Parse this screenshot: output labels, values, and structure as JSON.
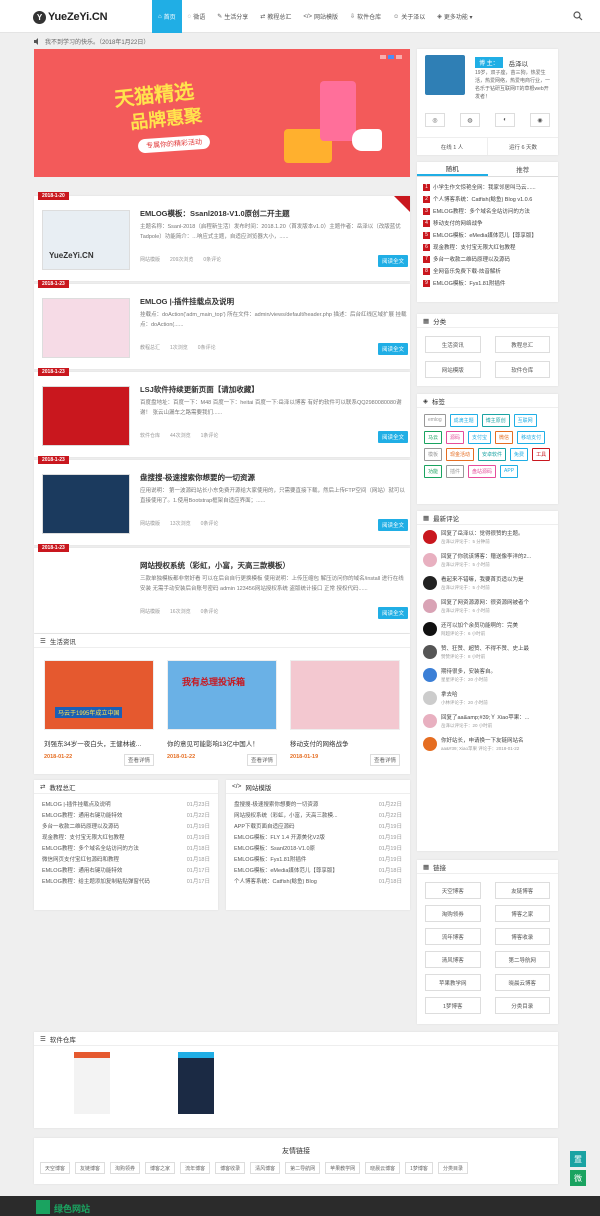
{
  "header": {
    "logo": "YueZeYi.CN",
    "nav": [
      {
        "icon": "home-icon",
        "glyph": "⌂",
        "label": "首页",
        "active": true
      },
      {
        "icon": "chat-icon",
        "glyph": "◌",
        "label": "微语"
      },
      {
        "icon": "edit-icon",
        "glyph": "✎",
        "label": "生活分享"
      },
      {
        "icon": "shuffle-icon",
        "glyph": "⇄",
        "label": "教程总汇"
      },
      {
        "icon": "code-icon",
        "glyph": "</>",
        "label": "网站模版"
      },
      {
        "icon": "download-icon",
        "glyph": "⇩",
        "label": "软件仓库"
      },
      {
        "icon": "user-icon",
        "glyph": "☺",
        "label": "关于泽以"
      },
      {
        "icon": "tag-icon",
        "glyph": "◈",
        "label": "更多功能 ▾"
      }
    ]
  },
  "notice": {
    "text": "我不到学习的快乐。（2018年1月22日）"
  },
  "slider": {
    "line1": "天猫精选",
    "line2": "品牌惠聚",
    "sub": "专属你的精彩活动"
  },
  "posts": [
    {
      "date": "2018-1-20",
      "title": "EMLOG模板：Ssanl2018-V1.0原创二开主题",
      "excerpt": "主题名称：Ssanl-2018（启程新生活）发布时间：2018.1.20（首发版本v1.0）主题作者：岳泽以（改版蓝优Tadpole）功能简介：...响应式主题，自适应浏览器大小，......",
      "cat": "网站模版",
      "views": "209次浏览",
      "comments": "0条评论",
      "more": "阅读全文",
      "top": true
    },
    {
      "date": "2018-1-23",
      "title": "EMLOG |-插件挂载点及说明",
      "excerpt": "挂载点：doAction('adm_main_top') 所在文件：admin/views/default/header.php 描述：后台红线区域扩展 挂载点：doAction(......",
      "cat": "教程总汇",
      "views": "1次浏览",
      "comments": "0条评论",
      "more": "阅读全文"
    },
    {
      "date": "2018-1-23",
      "title": "LSJ软件持续更新页面【请加收藏】",
      "excerpt": "百度盘地址：百度一下：M48 百度一下：heitai 百度一下:岳泽以博客 有好的软件可以联系QQ2980080080谢谢！ 张云山漏车之路需要我们......",
      "cat": "软件仓库",
      "views": "44次浏览",
      "comments": "1条评论",
      "more": "阅读全文"
    },
    {
      "date": "2018-1-23",
      "title": "盘搜搜-极速搜索你想要的一切资源",
      "excerpt": "应用说明：  第一波源码站长小东免费开源给大家使用的，只需要直接下载，然后上传FTP空间（网站）就可以直接使用了。1.使用Bootstrap框架自适应界面；......",
      "cat": "网站模版",
      "views": "13次浏览",
      "comments": "0条评论",
      "more": "阅读全文"
    },
    {
      "date": "2018-1-23",
      "title": "网站授权系统（彩虹，小富，天高三款模板）",
      "excerpt": "三款单独模板都非常好看 可以在后台自行更换模板 使用说明：上传压缩包 解压访问你的域名/install 进行在线安装 无需手动安装后台账号密码 admin 123456网站授权系统 盗版统计接口 正常 授权代码......",
      "cat": "网站模版",
      "views": "16次浏览",
      "comments": "0条评论",
      "more": "阅读全文"
    }
  ],
  "life": {
    "title": "生活资讯",
    "items": [
      {
        "title": "刘强东34岁一夜白头，王健林被...",
        "date": "2018-01-22",
        "btn": "查看详情",
        "img": "马云于1995年成立中国"
      },
      {
        "title": "你的意见可能影响13亿中国人！",
        "date": "2018-01-22",
        "btn": "查看详情",
        "img": "我有总理投诉箱"
      },
      {
        "title": "移动支付的网络战争",
        "date": "2018-01-19",
        "btn": "查看详情",
        "img": ""
      }
    ]
  },
  "tutorials": {
    "title": "教程总汇",
    "items": [
      {
        "t": "EMLOG |-插件挂载点及说明",
        "d": "01月23日"
      },
      {
        "t": "EMLOG教程：通用右键功能特效",
        "d": "01月22日"
      },
      {
        "t": "多台一收款二维码原理以及源码",
        "d": "01月19日"
      },
      {
        "t": "现金教程：支付宝无限大红包教程",
        "d": "01月19日"
      },
      {
        "t": "EMLOG教程：多个域名全站访问的方法",
        "d": "01月18日"
      },
      {
        "t": "微信网页支付宝红包源码和教程",
        "d": "01月18日"
      },
      {
        "t": "EMLOG教程：通用右键功能特效",
        "d": "01月17日"
      },
      {
        "t": "EMLOG教程：给主题添加复制粘贴弹窗代码",
        "d": "01月17日"
      }
    ]
  },
  "templates": {
    "title": "网站模版",
    "items": [
      {
        "t": "盘搜搜-极速搜索你想要的一切资源",
        "d": "01月22日"
      },
      {
        "t": "网站授权系统（彩虹，小富，天高三款模...",
        "d": "01月22日"
      },
      {
        "t": "APP下载页面自适应源码",
        "d": "01月19日"
      },
      {
        "t": "EMLOG模板：FLY 1.4 开源美化V2版",
        "d": "01月19日"
      },
      {
        "t": "EMLOG模板：Ssanl2018-V1.0原",
        "d": "01月19日"
      },
      {
        "t": "EMLOG模板：Fys1.81附插件",
        "d": "01月19日"
      },
      {
        "t": "EMLOG模板：eMedia媒体范儿【尊享版】",
        "d": "01月18日"
      },
      {
        "t": "个人博客系统：Catfish(鲶鱼) Blog",
        "d": "01月18日"
      }
    ]
  },
  "software": {
    "title": "软件仓库"
  },
  "links": {
    "title": "友情链接",
    "items": [
      "天空博客",
      "友链博客",
      "淘购领券",
      "博客之家",
      "流年博客",
      "博客收录",
      "清风博客",
      "第二导航网",
      "苹果教学网",
      "晓晨云博客",
      "1梦博客",
      "分类目录"
    ]
  },
  "profile": {
    "badge": "博 主：",
    "name": "岳泽以",
    "bio": "19岁，双子座，苗三狗，热爱生活，热爱网络，热爱电商行业，一名乐于钻研互联网IT的草根web开发者！",
    "online": "在线 1 人",
    "uptime": "运行 6 天数"
  },
  "rank": {
    "tabs": [
      "随机",
      "推荐"
    ],
    "items": [
      "小学生作文惊艳全网：我家邻居叫马云......",
      "个人博客系统：Catfish(鲶鱼) Blog v1.0.6",
      "EMLOG教程：多个域名全站访问的方法",
      "移动支付的网络战争",
      "EMLOG模板：eMedia媒体范儿【尊享版】",
      "现金教程：支付宝无限大红包教程",
      "多台一收款二维码原理以及源码",
      "全网音乐免费下载-炫音解析",
      "EMLOG模板：Fys1.81附插件"
    ]
  },
  "categories": {
    "title": "分类",
    "items": [
      "生活资讯",
      "教程总汇",
      "网站模版",
      "软件仓库"
    ]
  },
  "tagbox": {
    "title": "标签",
    "items": [
      {
        "t": "emlog",
        "c": "#999"
      },
      {
        "t": "成滴主题",
        "c": "#20aee5"
      },
      {
        "t": "博主原创",
        "c": "#1aa3a3"
      },
      {
        "t": "互联网",
        "c": "#20aee5"
      },
      {
        "t": "马云",
        "c": "#1aa360"
      },
      {
        "t": "源码",
        "c": "#e54d9b"
      },
      {
        "t": "支付宝",
        "c": "#20aee5"
      },
      {
        "t": "微信",
        "c": "#e56d21"
      },
      {
        "t": "移动支付",
        "c": "#20aee5"
      },
      {
        "t": "模板",
        "c": "#999"
      },
      {
        "t": "现金活动",
        "c": "#e56d21"
      },
      {
        "t": "安卓软件",
        "c": "#1aa3a3"
      },
      {
        "t": "免费",
        "c": "#20aee5"
      },
      {
        "t": "工具",
        "c": "#c9171e"
      },
      {
        "t": "功能",
        "c": "#1aa360"
      },
      {
        "t": "插件",
        "c": "#999"
      },
      {
        "t": "盘站源码",
        "c": "#e54d9b"
      },
      {
        "t": "APP",
        "c": "#20aee5"
      }
    ]
  },
  "comments": {
    "title": "最新评论",
    "items": [
      {
        "t": "回复了岳泽以：觉得很赞的主题。",
        "m": "岳泽以评论于：5 分钟前"
      },
      {
        "t": "回复了你就该博客：赠送像李洋的2...",
        "m": "岳泽以评论于：5 小时前"
      },
      {
        "t": "看起来不错嘛，我要首页适以为是",
        "m": "岳泽以评论于：5 小时前"
      },
      {
        "t": "回复了网资源源网：很资源网被者个",
        "m": "岳泽以评论于：6 小时前"
      },
      {
        "t": "还可以加个余员功能啊的：完美",
        "m": "阿超评论于：6 小时前"
      },
      {
        "t": "赞、狂赞、超赞、不得不赞、史上最",
        "m": "赞赞评论于：8 小时前"
      },
      {
        "t": "期待很多，安装客自。",
        "m": "星星评论于：20 小时前"
      },
      {
        "t": "拿去哈",
        "m": "小林评论于：20 小时前"
      },
      {
        "t": "回复了aa&amp;#39;Ｙ Xiao苹果：...",
        "m": "岳泽以评论于：20 小时前"
      },
      {
        "t": "你好站长，申请换一下友链网站名",
        "m": "aa&#39; Xiao苹果 评论于：2018-01-22"
      }
    ]
  },
  "friendlinks": {
    "title": "链接",
    "items": [
      "天空博客",
      "友链博客",
      "淘购领券",
      "博客之家",
      "流年博客",
      "博客收录",
      "清风博客",
      "第二导航网",
      "苹果教学网",
      "晓晨云博客",
      "1梦博客",
      "分类目录"
    ]
  },
  "float": {
    "top": "置",
    "wechat": "微"
  },
  "footer": {
    "brand": "绿色网站"
  }
}
